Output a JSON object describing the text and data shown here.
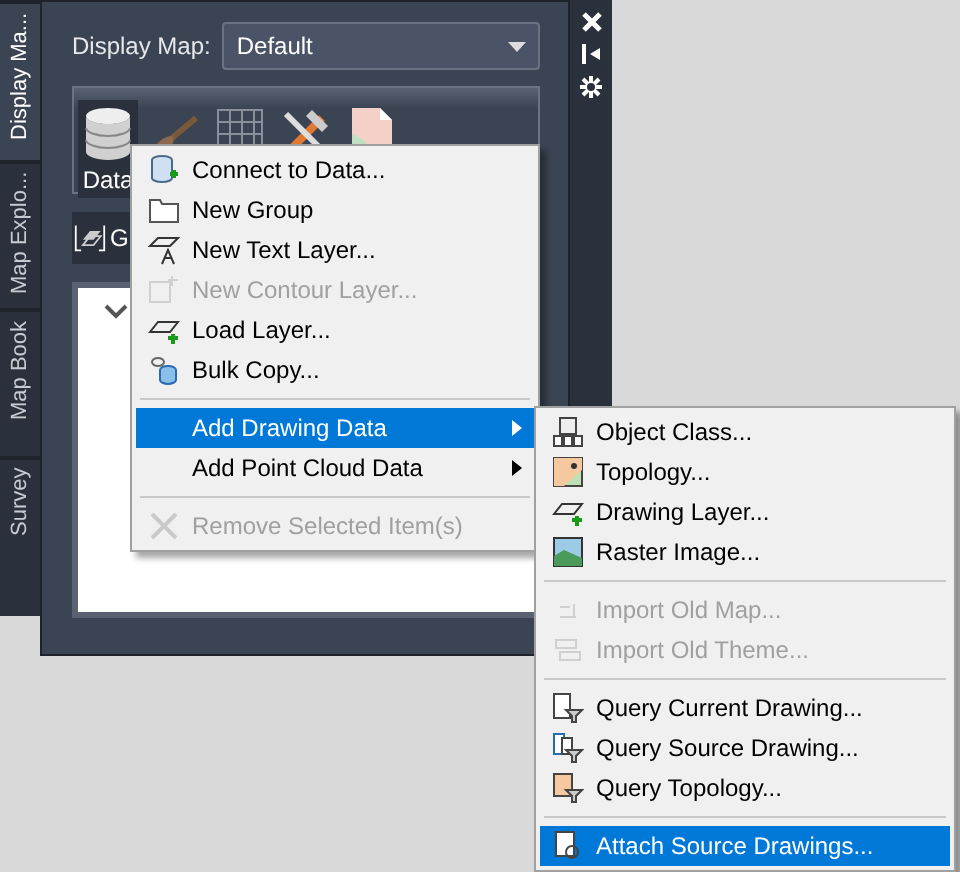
{
  "side_tabs": [
    {
      "label": "Display Ma...",
      "selected": true
    },
    {
      "label": "Map Explo...",
      "selected": false
    },
    {
      "label": "Map Book",
      "selected": false
    },
    {
      "label": "Survey",
      "selected": false
    }
  ],
  "display_map": {
    "label": "Display Map:",
    "value": "Default"
  },
  "toolbar": {
    "items": [
      {
        "label": "Data",
        "selected": true
      },
      {
        "selected": false
      },
      {
        "selected": false
      },
      {
        "selected": false
      },
      {
        "selected": false
      }
    ]
  },
  "layer_bar": {
    "label": "G"
  },
  "context_menu": [
    {
      "kind": "item",
      "label": "Connect to Data...",
      "disabled": false,
      "selected": false
    },
    {
      "kind": "item",
      "label": "New Group",
      "disabled": false,
      "selected": false
    },
    {
      "kind": "item",
      "label": "New Text Layer...",
      "disabled": false,
      "selected": false
    },
    {
      "kind": "item",
      "label": "New Contour Layer...",
      "disabled": true,
      "selected": false
    },
    {
      "kind": "item",
      "label": "Load Layer...",
      "disabled": false,
      "selected": false
    },
    {
      "kind": "item",
      "label": "Bulk Copy...",
      "disabled": false,
      "selected": false
    },
    {
      "kind": "separator"
    },
    {
      "kind": "submenu",
      "label": "Add Drawing Data",
      "disabled": false,
      "selected": true
    },
    {
      "kind": "submenu",
      "label": "Add Point Cloud Data",
      "disabled": false,
      "selected": false
    },
    {
      "kind": "separator"
    },
    {
      "kind": "item",
      "label": "Remove Selected Item(s)",
      "disabled": true,
      "selected": false
    }
  ],
  "submenu": [
    {
      "kind": "item",
      "label": "Object Class...",
      "disabled": false,
      "selected": false
    },
    {
      "kind": "item",
      "label": "Topology...",
      "disabled": false,
      "selected": false
    },
    {
      "kind": "item",
      "label": "Drawing Layer...",
      "disabled": false,
      "selected": false
    },
    {
      "kind": "item",
      "label": "Raster Image...",
      "disabled": false,
      "selected": false
    },
    {
      "kind": "separator"
    },
    {
      "kind": "item",
      "label": "Import Old Map...",
      "disabled": true,
      "selected": false
    },
    {
      "kind": "item",
      "label": "Import Old Theme...",
      "disabled": true,
      "selected": false
    },
    {
      "kind": "separator"
    },
    {
      "kind": "item",
      "label": "Query Current Drawing...",
      "disabled": false,
      "selected": false
    },
    {
      "kind": "item",
      "label": "Query Source Drawing...",
      "disabled": false,
      "selected": false
    },
    {
      "kind": "item",
      "label": "Query Topology...",
      "disabled": false,
      "selected": false
    },
    {
      "kind": "separator"
    },
    {
      "kind": "item",
      "label": "Attach Source Drawings...",
      "disabled": false,
      "selected": true
    }
  ]
}
